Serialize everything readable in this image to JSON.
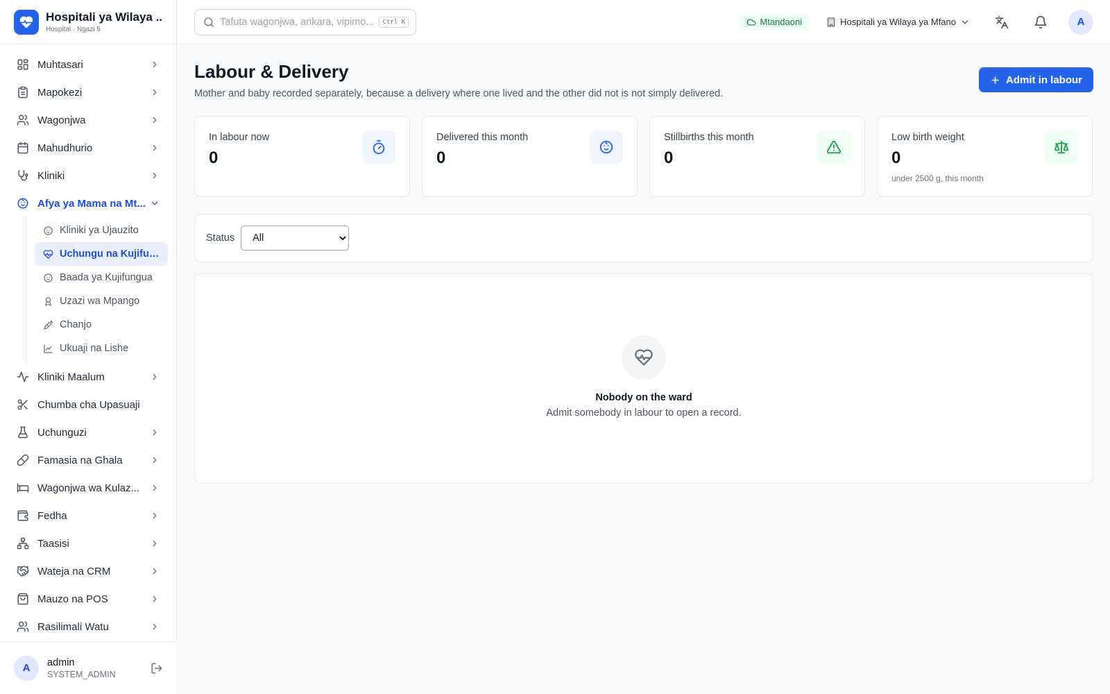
{
  "brand": {
    "title": "Hospitali ya Wilaya ...",
    "subtitle": "Hospital · Ngazi 5"
  },
  "sidebar": {
    "items": [
      {
        "label": "Muhtasari",
        "icon": "dashboard-icon"
      },
      {
        "label": "Mapokezi",
        "icon": "clipboard-icon"
      },
      {
        "label": "Wagonjwa",
        "icon": "users-icon"
      },
      {
        "label": "Mahudhurio",
        "icon": "calendar-icon"
      },
      {
        "label": "Kliniki",
        "icon": "stethoscope-icon"
      },
      {
        "label": "Afya ya Mama na Mt...",
        "icon": "baby-icon",
        "expanded": true
      }
    ],
    "subitems": [
      {
        "label": "Kliniki ya Ujauzito",
        "icon": "baby-icon"
      },
      {
        "label": "Uchungu na Kujifun...",
        "icon": "heart-pulse-icon",
        "active": true
      },
      {
        "label": "Baada ya Kujifungua",
        "icon": "baby-icon"
      },
      {
        "label": "Uzazi wa Mpango",
        "icon": "ribbon-icon"
      },
      {
        "label": "Chanjo",
        "icon": "syringe-icon"
      },
      {
        "label": "Ukuaji na Lishe",
        "icon": "chart-line-icon"
      }
    ],
    "items_after": [
      {
        "label": "Kliniki Maalum",
        "icon": "activity-icon"
      },
      {
        "label": "Chumba cha Upasuaji",
        "icon": "scissors-icon"
      },
      {
        "label": "Uchunguzi",
        "icon": "flask-icon"
      },
      {
        "label": "Famasia na Ghala",
        "icon": "pill-icon"
      },
      {
        "label": "Wagonjwa wa Kulaz...",
        "icon": "bed-icon"
      },
      {
        "label": "Fedha",
        "icon": "wallet-icon"
      },
      {
        "label": "Taasisi",
        "icon": "network-icon"
      },
      {
        "label": "Wateja na CRM",
        "icon": "handshake-icon"
      },
      {
        "label": "Mauzo na POS",
        "icon": "shopping-bag-icon"
      },
      {
        "label": "Rasilimali Watu",
        "icon": "users-icon"
      }
    ]
  },
  "user": {
    "initial": "A",
    "name": "admin",
    "role": "SYSTEM_ADMIN"
  },
  "topbar": {
    "search_placeholder": "Tafuta wagonjwa, ankara, vipimo...",
    "shortcut": "Ctrl K",
    "status": "Mtandaoni",
    "facility": "Hospitali ya Wilaya ya Mfano",
    "avatar_initial": "A"
  },
  "page": {
    "title": "Labour & Delivery",
    "description": "Mother and baby recorded separately, because a delivery where one lived and the other did not is not simply delivered.",
    "primary_action": "Admit in labour"
  },
  "stats": [
    {
      "label": "In labour now",
      "value": "0",
      "hint": "",
      "icon": "timer-icon",
      "tone": "blue"
    },
    {
      "label": "Delivered this month",
      "value": "0",
      "hint": "",
      "icon": "baby-icon",
      "tone": "blue"
    },
    {
      "label": "Stillbirths this month",
      "value": "0",
      "hint": "",
      "icon": "alert-triangle-icon",
      "tone": "green"
    },
    {
      "label": "Low birth weight",
      "value": "0",
      "hint": "under 2500 g, this month",
      "icon": "scale-icon",
      "tone": "green"
    }
  ],
  "filter": {
    "label": "Status",
    "selected": "All",
    "options": [
      "All"
    ]
  },
  "empty": {
    "title": "Nobody on the ward",
    "description": "Admit somebody in labour to open a record."
  },
  "colors": {
    "accent": "#2563eb",
    "success": "#16a34a"
  }
}
